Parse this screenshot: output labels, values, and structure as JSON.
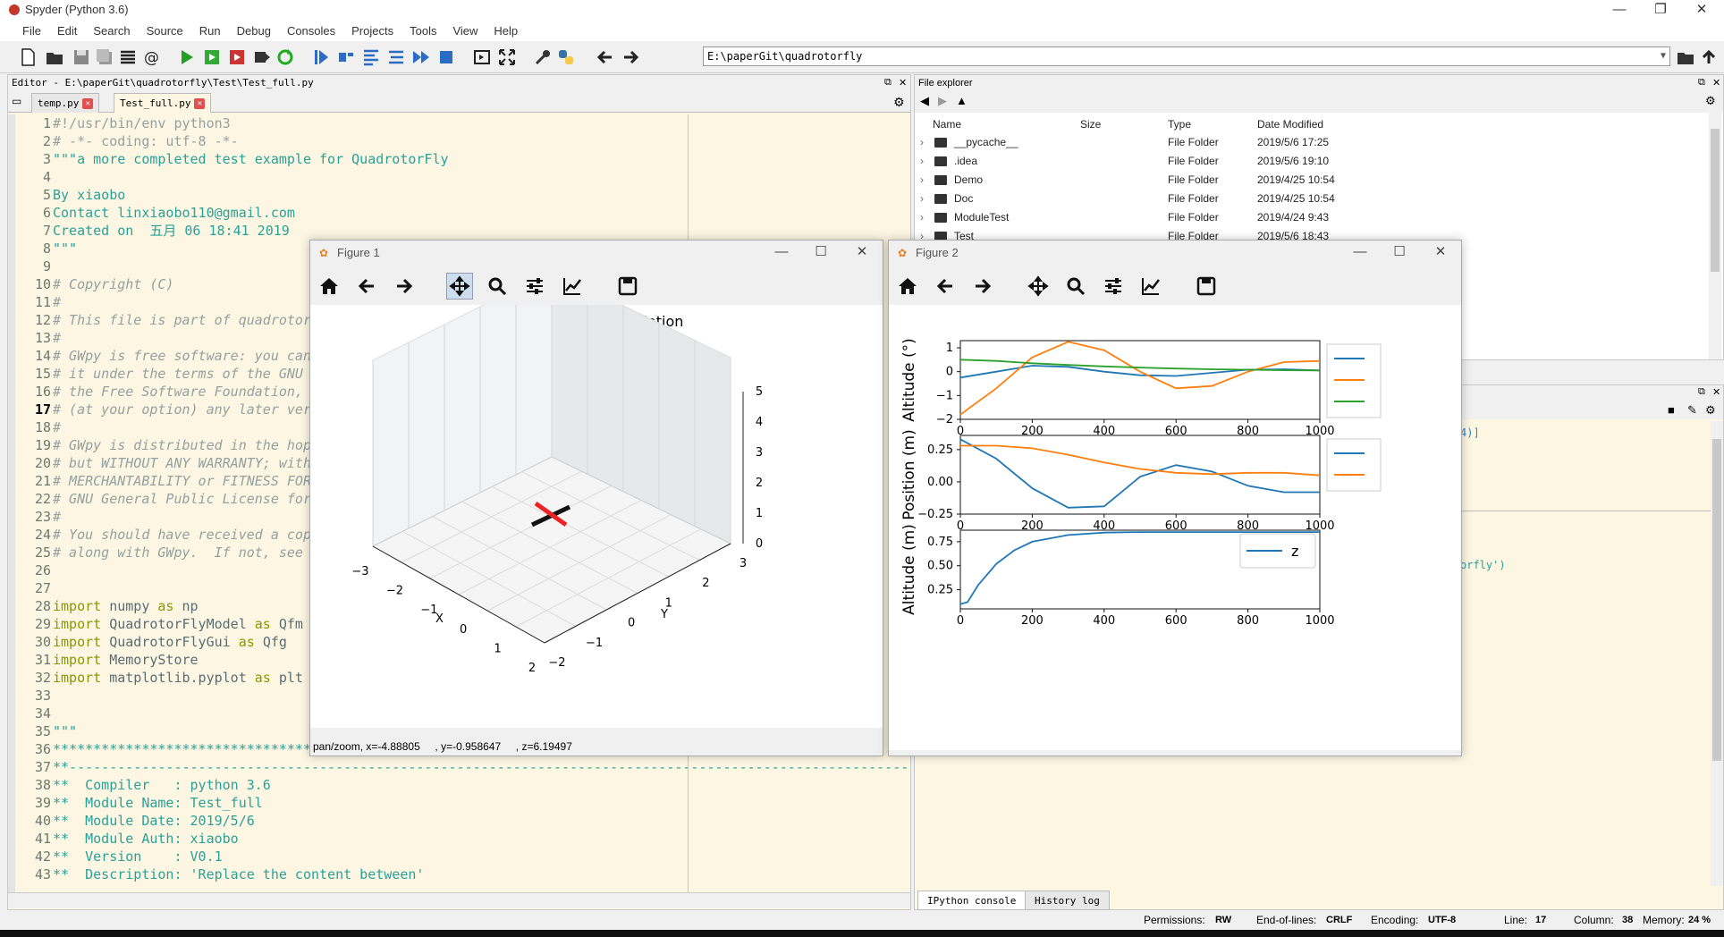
{
  "window": {
    "title": "Spyder (Python 3.6)"
  },
  "menu": [
    "File",
    "Edit",
    "Search",
    "Source",
    "Run",
    "Debug",
    "Consoles",
    "Projects",
    "Tools",
    "View",
    "Help"
  ],
  "path": "E:\\paperGit\\quadrotorfly",
  "editor": {
    "header": "Editor - E:\\paperGit\\quadrotorfly\\Test\\Test_full.py",
    "tabs": [
      {
        "label": "temp.py"
      },
      {
        "label": "Test_full.py"
      }
    ],
    "lines": [
      {
        "n": "1",
        "t": "#!/usr/bin/env python3",
        "c": "cm0"
      },
      {
        "n": "2",
        "t": "# -*- coding: utf-8 -*-",
        "c": "cm0"
      },
      {
        "n": "3",
        "t": "\"\"\"a more completed test example for QuadrotorFly",
        "c": ""
      },
      {
        "n": "4",
        "t": "",
        "c": ""
      },
      {
        "n": "5",
        "t": "By xiaobo",
        "c": ""
      },
      {
        "n": "6",
        "t": "Contact linxiaobo110@gmail.com",
        "c": ""
      },
      {
        "n": "7",
        "t": "Created on  五月 06 18:41 2019",
        "c": ""
      },
      {
        "n": "8",
        "t": "\"\"\"",
        "c": ""
      },
      {
        "n": "9",
        "t": "",
        "c": ""
      },
      {
        "n": "10",
        "t": "# Copyright (C)",
        "c": "cm"
      },
      {
        "n": "11",
        "t": "#",
        "c": "cm"
      },
      {
        "n": "12",
        "t": "# This file is part of quadrotor",
        "c": "cm"
      },
      {
        "n": "13",
        "t": "#",
        "c": "cm"
      },
      {
        "n": "14",
        "t": "# GWpy is free software: you can",
        "c": "cm"
      },
      {
        "n": "15",
        "t": "# it under the terms of the GNU",
        "c": "cm"
      },
      {
        "n": "16",
        "t": "# the Free Software Foundation,",
        "c": "cm"
      },
      {
        "n": "17",
        "t": "# (at your option) any later ver",
        "c": "cm"
      },
      {
        "n": "18",
        "t": "#",
        "c": "cm"
      },
      {
        "n": "19",
        "t": "# GWpy is distributed in the hop",
        "c": "cm"
      },
      {
        "n": "20",
        "t": "# but WITHOUT ANY WARRANTY; with",
        "c": "cm"
      },
      {
        "n": "21",
        "t": "# MERCHANTABILITY or FITNESS FOR",
        "c": "cm"
      },
      {
        "n": "22",
        "t": "# GNU General Public License for",
        "c": "cm"
      },
      {
        "n": "23",
        "t": "#",
        "c": "cm"
      },
      {
        "n": "24",
        "t": "# You should have received a cop",
        "c": "cm"
      },
      {
        "n": "25",
        "t": "# along with GWpy.  If not, see",
        "c": "cm"
      },
      {
        "n": "26",
        "t": "",
        "c": ""
      },
      {
        "n": "27",
        "t": "",
        "c": ""
      },
      {
        "n": "28",
        "t": "import numpy as np",
        "c": "kw"
      },
      {
        "n": "29",
        "t": "import QuadrotorFlyModel as Qfm",
        "c": "kw"
      },
      {
        "n": "30",
        "t": "import QuadrotorFlyGui as Qfg",
        "c": "kw"
      },
      {
        "n": "31",
        "t": "import MemoryStore",
        "c": "kw"
      },
      {
        "n": "32",
        "t": "import matplotlib.pyplot as plt",
        "c": "kw"
      },
      {
        "n": "33",
        "t": "",
        "c": ""
      },
      {
        "n": "34",
        "t": "",
        "c": ""
      },
      {
        "n": "35",
        "t": "\"\"\"",
        "c": ""
      },
      {
        "n": "36",
        "t": "****************************************",
        "c": ""
      },
      {
        "n": "37",
        "t": "**--------------------------------------------------------------------------------------------------------",
        "c": ""
      },
      {
        "n": "38",
        "t": "**  Compiler   : python 3.6",
        "c": ""
      },
      {
        "n": "39",
        "t": "**  Module Name: Test_full",
        "c": ""
      },
      {
        "n": "40",
        "t": "**  Module Date: 2019/5/6",
        "c": ""
      },
      {
        "n": "41",
        "t": "**  Module Auth: xiaobo",
        "c": ""
      },
      {
        "n": "42",
        "t": "**  Version    : V0.1",
        "c": ""
      },
      {
        "n": "43",
        "t": "**  Description: 'Replace the content between'",
        "c": ""
      }
    ]
  },
  "explorer": {
    "header": "File explorer",
    "columns": [
      "Name",
      "Size",
      "Type",
      "Date Modified"
    ],
    "rows": [
      {
        "name": "__pycache__",
        "type": "File Folder",
        "date": "2019/5/6 17:25"
      },
      {
        "name": ".idea",
        "type": "File Folder",
        "date": "2019/5/6 19:10"
      },
      {
        "name": "Demo",
        "type": "File Folder",
        "date": "2019/4/25 10:54"
      },
      {
        "name": "Doc",
        "type": "File Folder",
        "date": "2019/4/25 10:54"
      },
      {
        "name": "ModuleTest",
        "type": "File Folder",
        "date": "2019/4/24 9:43"
      },
      {
        "name": "Test",
        "type": "File Folder",
        "date": "2019/5/6 18:43"
      }
    ]
  },
  "console": {
    "frag1": "4)]",
    "frag2": "orfly')"
  },
  "bottom_tabs": [
    "IPython console",
    "History log"
  ],
  "status": {
    "permissions_label": "Permissions:",
    "permissions": "RW",
    "eol_label": "End-of-lines:",
    "eol": "CRLF",
    "encoding_label": "Encoding:",
    "encoding": "UTF-8",
    "line_label": "Line:",
    "line": "17",
    "column_label": "Column:",
    "column": "38",
    "memory_label": "Memory:",
    "memory": "24 %"
  },
  "figure1": {
    "title": "Figure 1",
    "plot_title": "QuadrotorFly Simulation",
    "status": "pan/zoom, x=-4.88805     , y=-0.958647     , z=6.19497",
    "xlabel": "X",
    "ylabel": "Y",
    "xticks": [
      "−3",
      "−2",
      "−1",
      "0",
      "1",
      "2"
    ],
    "yticks": [
      "3",
      "2",
      "1",
      "0",
      "−1",
      "−2"
    ],
    "zticks": [
      "5",
      "4",
      "3",
      "2",
      "1",
      "0"
    ]
  },
  "figure2": {
    "title": "Figure 2"
  },
  "chart_data": [
    {
      "type": "line",
      "ylabel": "Altitude (°)",
      "xlim": [
        0,
        1000
      ],
      "ylim": [
        -2,
        1.3
      ],
      "xticks": [
        0,
        200,
        400,
        600,
        800,
        1000
      ],
      "yticks": [
        1,
        0,
        -1,
        -2
      ],
      "x": [
        0,
        100,
        200,
        300,
        400,
        500,
        600,
        700,
        800,
        900,
        1000
      ],
      "series": [
        {
          "color": "#1f77b4",
          "values": [
            -0.25,
            0.0,
            0.25,
            0.2,
            0.0,
            -0.15,
            -0.18,
            -0.05,
            0.08,
            0.1,
            0.05
          ]
        },
        {
          "color": "#ff7f0e",
          "values": [
            -1.8,
            -0.7,
            0.6,
            1.25,
            0.9,
            0.0,
            -0.7,
            -0.6,
            0.0,
            0.4,
            0.45
          ]
        },
        {
          "color": "#2ca02c",
          "values": [
            0.5,
            0.45,
            0.35,
            0.28,
            0.22,
            0.17,
            0.13,
            0.1,
            0.08,
            0.06,
            0.05
          ]
        }
      ]
    },
    {
      "type": "line",
      "ylabel": "Position (m)",
      "xlim": [
        0,
        1000
      ],
      "ylim": [
        -0.25,
        0.36
      ],
      "xticks": [
        0,
        200,
        400,
        600,
        800,
        1000
      ],
      "yticks": [
        "0.25",
        "0.00",
        "−0.25"
      ],
      "x": [
        0,
        100,
        200,
        300,
        400,
        500,
        600,
        700,
        800,
        900,
        1000
      ],
      "series": [
        {
          "color": "#1f77b4",
          "values": [
            0.33,
            0.18,
            -0.05,
            -0.2,
            -0.19,
            0.04,
            0.13,
            0.08,
            -0.03,
            -0.08,
            -0.08
          ]
        },
        {
          "color": "#ff7f0e",
          "values": [
            0.28,
            0.28,
            0.26,
            0.21,
            0.15,
            0.1,
            0.07,
            0.06,
            0.07,
            0.07,
            0.05
          ]
        }
      ]
    },
    {
      "type": "line",
      "ylabel": "Altitude (m)",
      "xlim": [
        0,
        1000
      ],
      "ylim": [
        0.05,
        0.87
      ],
      "xticks": [
        0,
        200,
        400,
        600,
        800,
        1000
      ],
      "yticks": [
        "0.75",
        "0.50",
        "0.25"
      ],
      "x": [
        0,
        20,
        50,
        100,
        150,
        200,
        300,
        400,
        500,
        600,
        800,
        1000
      ],
      "series": [
        {
          "name": "z",
          "color": "#1f77b4",
          "values": [
            0.1,
            0.12,
            0.3,
            0.52,
            0.66,
            0.75,
            0.82,
            0.845,
            0.85,
            0.85,
            0.85,
            0.85
          ]
        }
      ]
    }
  ]
}
